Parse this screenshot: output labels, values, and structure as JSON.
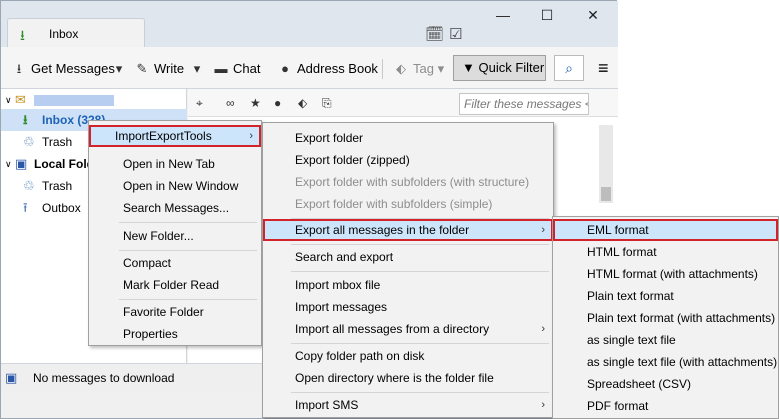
{
  "window": {
    "tab_label": "Inbox"
  },
  "toolbar": {
    "get_messages": "Get Messages",
    "write": "Write",
    "chat": "Chat",
    "address_book": "Address Book",
    "tag": "Tag",
    "quick_filter": "Quick Filter"
  },
  "folders": {
    "inbox": "Inbox (328)",
    "trash1": "Trash",
    "local_folders": "Local Fold",
    "trash2": "Trash",
    "outbox": "Outbox"
  },
  "msgbar": {
    "filter_placeholder": "Filter these messages <C"
  },
  "status": {
    "text": "No messages to download"
  },
  "context_menu": {
    "items": [
      "ImportExportTools",
      "Open in New Tab",
      "Open in New Window",
      "Search Messages...",
      "New Folder...",
      "Compact",
      "Mark Folder Read",
      "Favorite Folder",
      "Properties"
    ]
  },
  "submenu1": {
    "items": [
      "Export folder",
      "Export folder (zipped)",
      "Export folder with subfolders (with structure)",
      "Export folder with subfolders (simple)",
      "Export all messages in the folder",
      "Search and export",
      "Import mbox file",
      "Import messages",
      "Import all messages from a directory",
      "Copy folder path on disk",
      "Open directory where is the folder file",
      "Import SMS"
    ]
  },
  "submenu2": {
    "items": [
      "EML format",
      "HTML format",
      "HTML format (with attachments)",
      "Plain text format",
      "Plain text format (with attachments)",
      "as single text file",
      "as single text file (with attachments)",
      "Spreadsheet (CSV)",
      "PDF format"
    ]
  },
  "colors": {
    "highlight_border": "#d2232a",
    "highlight_bg": "#cce5fb",
    "inbox_text": "#1c63b7"
  }
}
